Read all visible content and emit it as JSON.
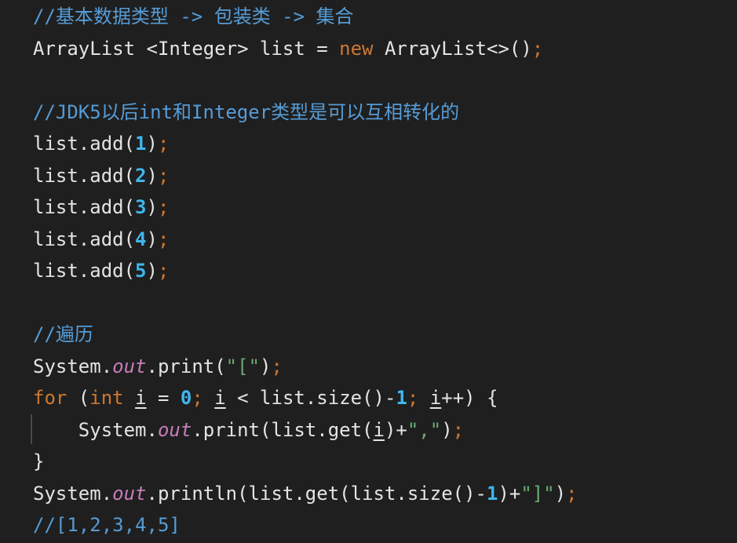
{
  "lines": [
    {
      "tokens": [
        {
          "t": "//基本数据类型 -> 包装类 -> 集合",
          "k": "comment"
        }
      ]
    },
    {
      "tokens": [
        {
          "t": "ArrayList <Integer> list = ",
          "k": "plain"
        },
        {
          "t": "new",
          "k": "kw"
        },
        {
          "t": " ArrayList<>()",
          "k": "plain"
        },
        {
          "t": ";",
          "k": "punct"
        }
      ]
    },
    {
      "tokens": []
    },
    {
      "tokens": [
        {
          "t": "//JDK5以后int和Integer类型是可以互相转化的",
          "k": "comment"
        }
      ]
    },
    {
      "tokens": [
        {
          "t": "list.add(",
          "k": "plain"
        },
        {
          "t": "1",
          "k": "num"
        },
        {
          "t": ")",
          "k": "plain"
        },
        {
          "t": ";",
          "k": "punct"
        }
      ]
    },
    {
      "tokens": [
        {
          "t": "list.add(",
          "k": "plain"
        },
        {
          "t": "2",
          "k": "num"
        },
        {
          "t": ")",
          "k": "plain"
        },
        {
          "t": ";",
          "k": "punct"
        }
      ]
    },
    {
      "tokens": [
        {
          "t": "list.add(",
          "k": "plain"
        },
        {
          "t": "3",
          "k": "num"
        },
        {
          "t": ")",
          "k": "plain"
        },
        {
          "t": ";",
          "k": "punct"
        }
      ]
    },
    {
      "tokens": [
        {
          "t": "list.add(",
          "k": "plain"
        },
        {
          "t": "4",
          "k": "num"
        },
        {
          "t": ")",
          "k": "plain"
        },
        {
          "t": ";",
          "k": "punct"
        }
      ]
    },
    {
      "tokens": [
        {
          "t": "list.add(",
          "k": "plain"
        },
        {
          "t": "5",
          "k": "num"
        },
        {
          "t": ")",
          "k": "plain"
        },
        {
          "t": ";",
          "k": "punct"
        }
      ]
    },
    {
      "tokens": []
    },
    {
      "tokens": [
        {
          "t": "//遍历",
          "k": "comment"
        }
      ]
    },
    {
      "tokens": [
        {
          "t": "System.",
          "k": "plain"
        },
        {
          "t": "out",
          "k": "field"
        },
        {
          "t": ".print(",
          "k": "plain"
        },
        {
          "t": "\"[\"",
          "k": "str"
        },
        {
          "t": ")",
          "k": "plain"
        },
        {
          "t": ";",
          "k": "punct"
        }
      ]
    },
    {
      "tokens": [
        {
          "t": "for",
          "k": "kw"
        },
        {
          "t": " (",
          "k": "plain"
        },
        {
          "t": "int",
          "k": "kw"
        },
        {
          "t": " ",
          "k": "plain"
        },
        {
          "t": "i",
          "k": "var"
        },
        {
          "t": " = ",
          "k": "plain"
        },
        {
          "t": "0",
          "k": "num"
        },
        {
          "t": ";",
          "k": "punct"
        },
        {
          "t": " ",
          "k": "plain"
        },
        {
          "t": "i",
          "k": "var"
        },
        {
          "t": " < list.size()-",
          "k": "plain"
        },
        {
          "t": "1",
          "k": "num"
        },
        {
          "t": ";",
          "k": "punct"
        },
        {
          "t": " ",
          "k": "plain"
        },
        {
          "t": "i",
          "k": "var"
        },
        {
          "t": "++) {",
          "k": "plain"
        }
      ]
    },
    {
      "tokens": [
        {
          "t": "    System.",
          "k": "plain"
        },
        {
          "t": "out",
          "k": "field"
        },
        {
          "t": ".print(list.get(",
          "k": "plain"
        },
        {
          "t": "i",
          "k": "var"
        },
        {
          "t": ")+",
          "k": "plain"
        },
        {
          "t": "\",\"",
          "k": "str"
        },
        {
          "t": ")",
          "k": "plain"
        },
        {
          "t": ";",
          "k": "punct"
        }
      ]
    },
    {
      "tokens": [
        {
          "t": "}",
          "k": "plain"
        }
      ]
    },
    {
      "tokens": [
        {
          "t": "System.",
          "k": "plain"
        },
        {
          "t": "out",
          "k": "field"
        },
        {
          "t": ".println(list.get(list.size()-",
          "k": "plain"
        },
        {
          "t": "1",
          "k": "num"
        },
        {
          "t": ")+",
          "k": "plain"
        },
        {
          "t": "\"]\"",
          "k": "str"
        },
        {
          "t": ")",
          "k": "plain"
        },
        {
          "t": ";",
          "k": "punct"
        }
      ]
    },
    {
      "tokens": [
        {
          "t": "//[1,2,3,4,5]",
          "k": "comment"
        }
      ]
    }
  ],
  "colors": {
    "background": "#1f1f1f",
    "comment": "#569cd6",
    "keyword": "#cc7832",
    "number": "#3fb6ee",
    "string": "#6aab73",
    "field": "#c77dbb",
    "plain": "#e4e4e4"
  }
}
